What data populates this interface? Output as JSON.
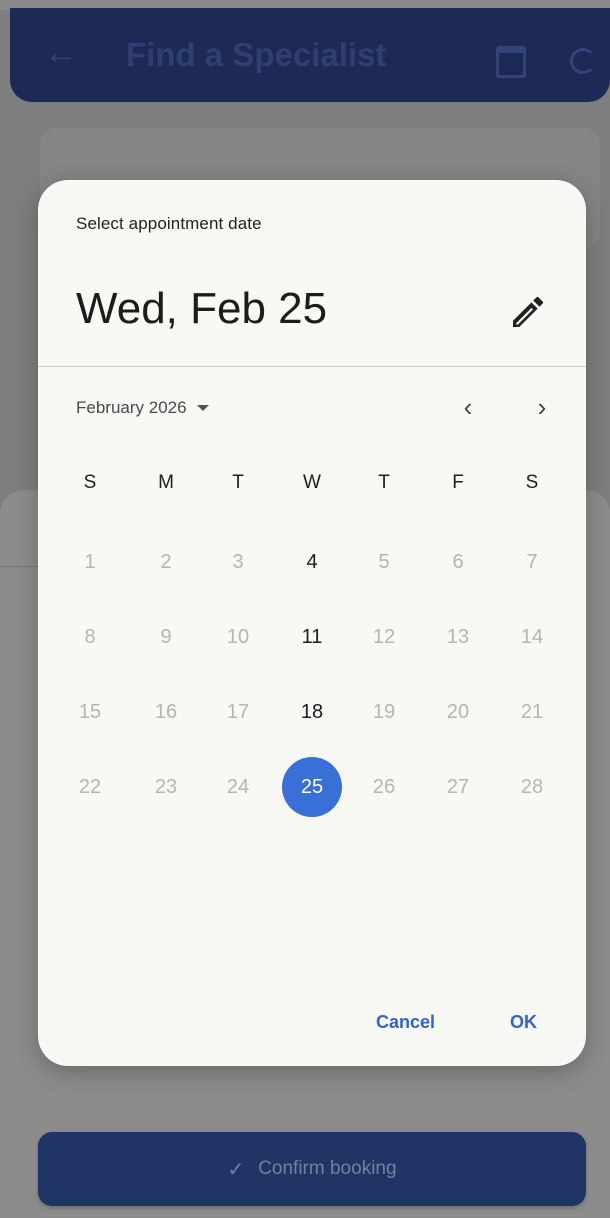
{
  "app": {
    "title": "Find a Specialist",
    "back_icon": "arrow-left-icon",
    "calendar_icon": "calendar-icon",
    "refresh_icon": "refresh-icon"
  },
  "dialog": {
    "help_text": "Select appointment date",
    "header_date": "Wed, Feb 25",
    "edit_icon": "pencil-icon",
    "month_label": "February 2026",
    "prev_icon": "chevron-left-icon",
    "next_icon": "chevron-right-icon",
    "weekdays": [
      "S",
      "M",
      "T",
      "W",
      "T",
      "F",
      "S"
    ],
    "weeks": [
      [
        "1",
        "2",
        "3",
        "4",
        "5",
        "6",
        "7"
      ],
      [
        "8",
        "9",
        "10",
        "11",
        "12",
        "13",
        "14"
      ],
      [
        "15",
        "16",
        "17",
        "18",
        "19",
        "20",
        "21"
      ],
      [
        "22",
        "23",
        "24",
        "25",
        "26",
        "27",
        "28"
      ]
    ],
    "enabled_days": [
      "4",
      "11",
      "18",
      "25"
    ],
    "selected_day": "25",
    "cancel_label": "Cancel",
    "ok_label": "OK"
  },
  "footer": {
    "confirm_label": "Confirm booking",
    "confirm_icon": "check-icon"
  },
  "colors": {
    "accent": "#3a6fd8",
    "appbar": "#1e2a55",
    "dialog_bg": "#f8f8f4"
  }
}
